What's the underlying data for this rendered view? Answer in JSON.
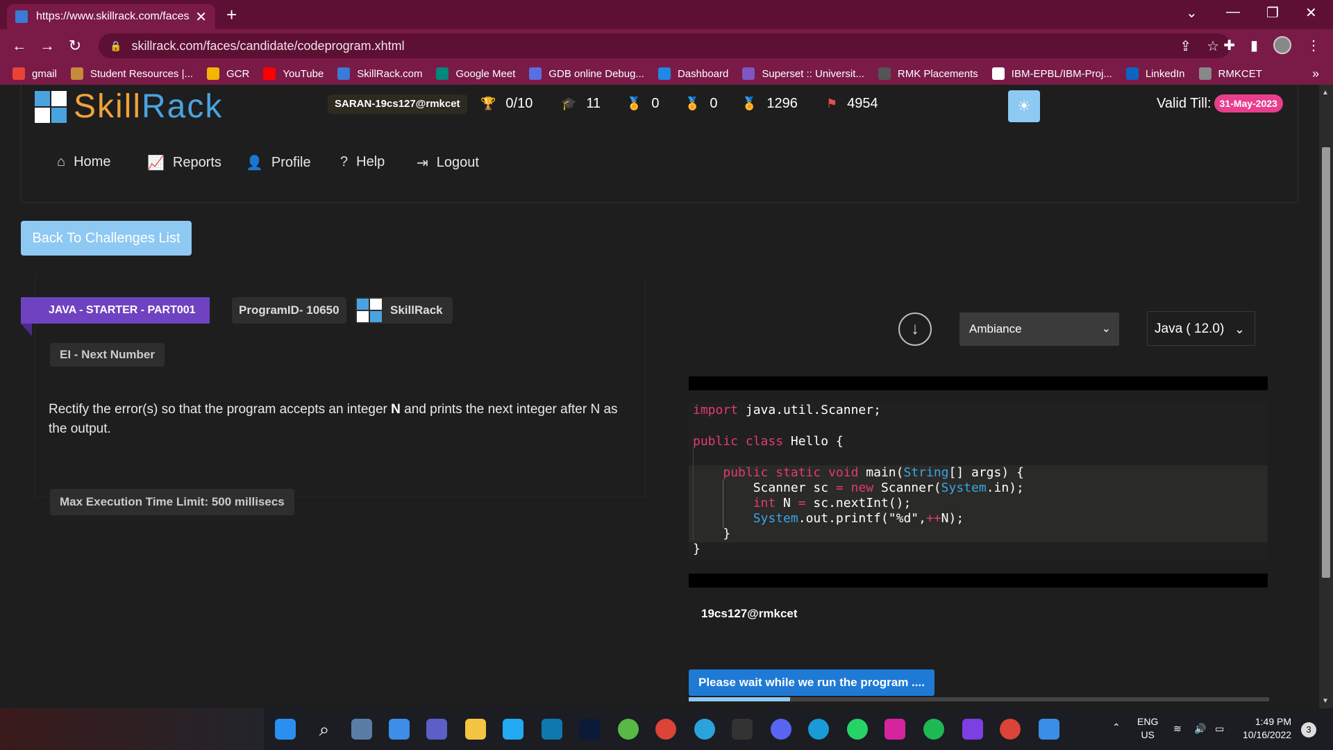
{
  "browser": {
    "tab_title": "https://www.skillrack.com/faces/c",
    "url": "skillrack.com/faces/candidate/codeprogram.xhtml",
    "bookmarks": [
      {
        "label": "gmail",
        "color": "#ea4335"
      },
      {
        "label": "Student Resources |...",
        "color": "#c58a3a"
      },
      {
        "label": "GCR",
        "color": "#f4b400"
      },
      {
        "label": "YouTube",
        "color": "#ff0000"
      },
      {
        "label": "SkillRack.com",
        "color": "#3a7bd5"
      },
      {
        "label": "Google Meet",
        "color": "#00897b"
      },
      {
        "label": "GDB online Debug...",
        "color": "#5b6ee1"
      },
      {
        "label": "Dashboard",
        "color": "#1e88e5"
      },
      {
        "label": "Superset :: Universit...",
        "color": "#7e57c2"
      },
      {
        "label": "RMK Placements",
        "color": "#555555"
      },
      {
        "label": "IBM-EPBL/IBM-Proj...",
        "color": "#ffffff"
      },
      {
        "label": "LinkedIn",
        "color": "#0a66c2"
      },
      {
        "label": "RMKCET",
        "color": "#888888"
      }
    ]
  },
  "header": {
    "logo_part1": "Skill",
    "logo_part2": "Rack",
    "user_badge": "SARAN-19cs127@rmkcet",
    "stats": [
      {
        "icon": "trophy-icon",
        "glyph": "🏆",
        "value": "0/10"
      },
      {
        "icon": "graduation-cap-icon",
        "glyph": "🎓",
        "value": "11"
      },
      {
        "icon": "gold-medal-icon",
        "glyph": "🏅",
        "value": "0"
      },
      {
        "icon": "silver-medal-icon",
        "glyph": "🏅",
        "value": "0"
      },
      {
        "icon": "bronze-medal-icon",
        "glyph": "🏅",
        "value": "1296"
      },
      {
        "icon": "flag-icon",
        "glyph": "⚑",
        "value": "4954"
      }
    ],
    "valid_label": "Valid Till:",
    "valid_date": "31-May-2023"
  },
  "nav": [
    {
      "icon": "home-icon",
      "glyph": "⌂",
      "label": "Home"
    },
    {
      "icon": "reports-icon",
      "glyph": "📈",
      "label": "Reports"
    },
    {
      "icon": "profile-icon",
      "glyph": "👤",
      "label": "Profile"
    },
    {
      "icon": "help-icon",
      "glyph": "?",
      "label": "Help"
    },
    {
      "icon": "logout-icon",
      "glyph": "⇥",
      "label": "Logout"
    }
  ],
  "back_button": "Back To Challenges List",
  "problem": {
    "category": "JAVA - STARTER - PART001",
    "program_id": "ProgramID- 10650",
    "source": "SkillRack",
    "title": "EI - Next Number",
    "desc_a": "Rectify the error(s) so that the program accepts an integer ",
    "desc_b": "N",
    "desc_c": " and prints the next integer after N as the output.",
    "time_limit": "Max Execution Time Limit: 500 millisecs"
  },
  "editor": {
    "theme": "Ambiance",
    "language": "Java ( 12.0)"
  },
  "console": {
    "user": "19cs127@rmkcet",
    "status": "Please wait while we run the program ....",
    "progress": 0.175
  },
  "taskbar": {
    "lang": "ENG",
    "region": "US",
    "time": "1:49 PM",
    "date": "10/16/2022",
    "notifications": "3"
  }
}
